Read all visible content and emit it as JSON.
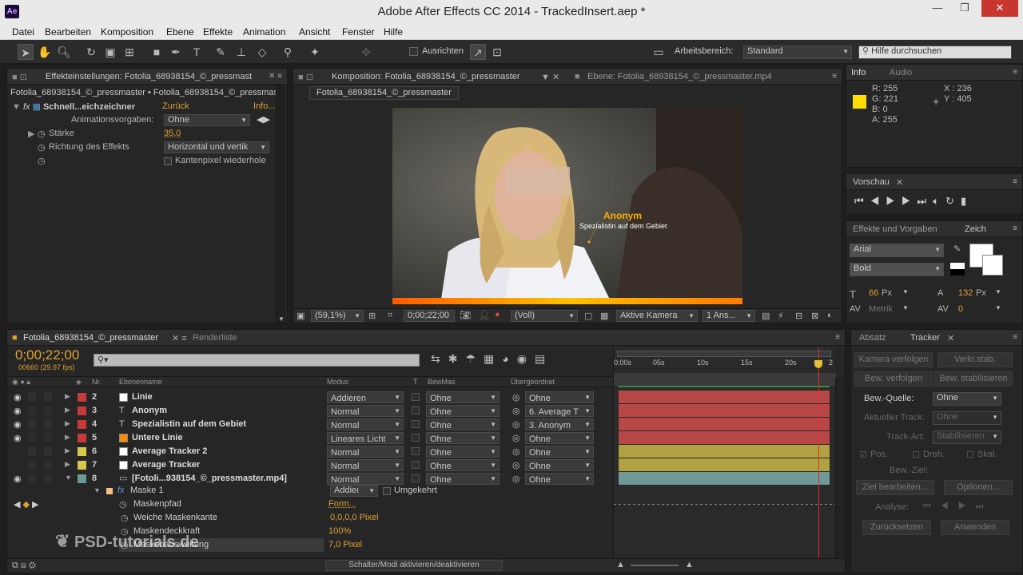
{
  "window": {
    "title": "Adobe After Effects CC 2014 - TrackedInsert.aep *",
    "logo": "Ae"
  },
  "menu": [
    "Datei",
    "Bearbeiten",
    "Komposition",
    "Ebene",
    "Effekte",
    "Animation",
    "Ansicht",
    "Fenster",
    "Hilfe"
  ],
  "toolbar": {
    "align_label": "Ausrichten",
    "workspace_label": "Arbeitsbereich:",
    "workspace_value": "Standard",
    "help_placeholder": "Hilfe durchsuchen"
  },
  "effects_panel": {
    "tab": "Effekteinstellungen: Fotolia_68938154_©_pressmast",
    "breadcrumb": "Fotolia_68938154_©_pressmaster • Fotolia_68938154_©_pressmas",
    "effect_name": "Schnell...eichzeichner",
    "reset": "Zurück",
    "info": "Info...",
    "presets_label": "Animationsvorgaben:",
    "presets_value": "Ohne",
    "strength_label": "Stärke",
    "strength_value": "35,0",
    "direction_label": "Richtung des Effekts",
    "direction_value": "Horizontal und vertik",
    "edge_label": "Kantenpixel wiederhole"
  },
  "comp_panel": {
    "tab": "Komposition: Fotolia_68938154_©_pressmaster",
    "layer_tab": "Ebene: Fotolia_68938154_©_pressmaster.mp4",
    "subtab": "Fotolia_68938154_©_pressmaster",
    "overlay_name": "Anonym",
    "overlay_sub": "Spezialistin auf dem Gebiet",
    "zoom": "(59,1%)",
    "timecode": "0;00;22;00",
    "quality": "(Voll)",
    "camera": "Aktive Kamera",
    "views": "1 Ans..."
  },
  "info_panel": {
    "tabs": [
      "Info",
      "Audio"
    ],
    "r": "R: 255",
    "g": "G: 221",
    "b": "B: 0",
    "a": "A: 255",
    "x": "X : 236",
    "y": "Y : 405",
    "swatch_color": "#ffdd00"
  },
  "preview_panel": {
    "tab": "Vorschau"
  },
  "char_panel": {
    "tabs": [
      "Effekte und Vorgaben",
      "Zeich"
    ],
    "font": "Arial",
    "style": "Bold",
    "size": "66",
    "size_unit": "Px",
    "leading": "132",
    "leading_unit": "Px",
    "kerning": "Metrik",
    "tracking": "0"
  },
  "tracker_panel": {
    "tabs": [
      "Absatz",
      "Tracker"
    ],
    "btn_camera": "Kamera verfolgen",
    "btn_warp": "Verkr.stab.",
    "btn_track": "Bew. verfolgen",
    "btn_stab": "Bew. stabilisieren",
    "source_label": "Bew.-Quelle:",
    "source_value": "Ohne",
    "current_label": "Aktueller Track:",
    "current_value": "Ohne",
    "type_label": "Track-Art:",
    "type_value": "Stabilisieren",
    "pos": "Pos.",
    "rot": "Dreh.",
    "scale": "Skal.",
    "target_label": "Bew.-Ziel:",
    "edit_target": "Ziel bearbeiten...",
    "options": "Optionen...",
    "analyze": "Analyse:",
    "reset": "Zurücksetzen",
    "apply": "Anwenden"
  },
  "timeline": {
    "tab": "Fotolia_68938154_©_pressmaster",
    "render_tab": "Renderliste",
    "timecode": "0;00;22;00",
    "fps": "00660 (29.97 fps)",
    "search_placeholder": "",
    "headers": {
      "nr": "Nr.",
      "name": "Ebenenname",
      "mode": "Modus",
      "t": "T",
      "trkmat": "BewMas",
      "parent": "Übergeordnet"
    },
    "ruler": [
      "0:00s",
      "05s",
      "10s",
      "15s",
      "20s",
      "2"
    ],
    "layers": [
      {
        "nr": "2",
        "name": "Linie",
        "mode": "Addieren",
        "trk": "Ohne",
        "parent": "Ohne",
        "label": "#c83a3a",
        "icon": "#ffffff",
        "bar": "#b84848"
      },
      {
        "nr": "3",
        "name": "Anonym",
        "mode": "Normal",
        "trk": "Ohne",
        "parent": "6. Average T",
        "label": "#c83a3a",
        "icon": "T",
        "bar": "#b84848"
      },
      {
        "nr": "4",
        "name": "Spezialistin auf dem Gebiet",
        "mode": "Normal",
        "trk": "Ohne",
        "parent": "3. Anonym",
        "label": "#c83a3a",
        "icon": "T",
        "bar": "#b84848"
      },
      {
        "nr": "5",
        "name": "Untere Linie",
        "mode": "Lineares Licht",
        "trk": "Ohne",
        "parent": "Ohne",
        "label": "#c83a3a",
        "icon": "#ff8c00",
        "bar": "#b84848"
      },
      {
        "nr": "6",
        "name": "Average Tracker 2",
        "mode": "Normal",
        "trk": "Ohne",
        "parent": "Ohne",
        "label": "#d8c84a",
        "icon": "#ffffff",
        "bar": "#b0a240"
      },
      {
        "nr": "7",
        "name": "Average Tracker",
        "mode": "Normal",
        "trk": "Ohne",
        "parent": "Ohne",
        "label": "#d8c84a",
        "icon": "#ffffff",
        "bar": "#b0a240"
      },
      {
        "nr": "8",
        "name": "[Fotoli...938154_©_pressmaster.mp4]",
        "mode": "Normal",
        "trk": "Ohne",
        "parent": "Ohne",
        "label": "#6a9a94",
        "icon": "film",
        "bar": "#6e9994"
      }
    ],
    "mask": {
      "name": "Maske 1",
      "mode": "Addieı",
      "inverted": "Umgekehrt",
      "path_label": "Maskenpfad",
      "path_value": "Form...",
      "feather_label": "Weiche Maskenkante",
      "feather_value": "0,0,0,0 Pixel",
      "opacity_label": "Maskendeckkraft",
      "opacity_value": "100%",
      "expansion_label": "Maskenausweitung",
      "expansion_value": "7,0 Pixel"
    },
    "toggle_label": "Schalter/Modi aktivieren/deaktivieren",
    "playhead_fraction": 0.92
  },
  "watermark": "PSD-tutorials.de"
}
